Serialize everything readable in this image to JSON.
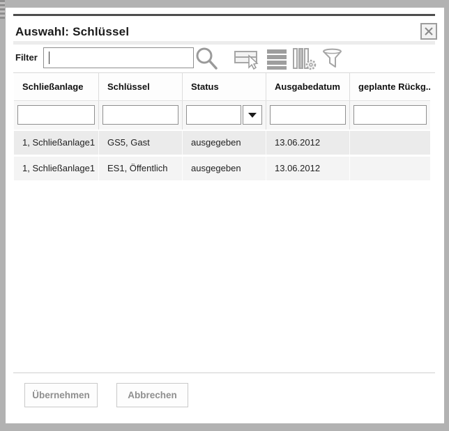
{
  "dialog": {
    "title": "Auswahl: Schlüssel"
  },
  "filter": {
    "label": "Filter",
    "value": "",
    "placeholder": ""
  },
  "toolbar": {
    "icons": [
      "search-icon",
      "select-rows-icon",
      "list-rows-icon",
      "columns-settings-icon",
      "filter-funnel-icon"
    ]
  },
  "table": {
    "columns": [
      "Schließanlage",
      "Schlüssel",
      "Status",
      "Ausgabedatum",
      "geplante Rückg..."
    ],
    "filter_row": {
      "values": [
        "",
        "",
        "",
        "",
        ""
      ],
      "status_dropdown_icon": "caret-down-icon"
    },
    "rows": [
      [
        "1, Schließanlage1",
        "GS5, Gast",
        "ausgegeben",
        "13.06.2012",
        ""
      ],
      [
        "1, Schließanlage1",
        "ES1, Öffentlich",
        "ausgegeben",
        "13.06.2012",
        ""
      ]
    ]
  },
  "buttons": {
    "apply": "Übernehmen",
    "cancel": "Abbrechen"
  },
  "colors": {
    "overlay": "#b2b2b2",
    "accent_bar": "#4d4d4d",
    "row_odd": "#ebebeb",
    "row_even": "#f4f4f4",
    "icon_gray": "#a6a6a6",
    "input_border": "#8f8f8f",
    "button_text": "#8f8f8f"
  }
}
